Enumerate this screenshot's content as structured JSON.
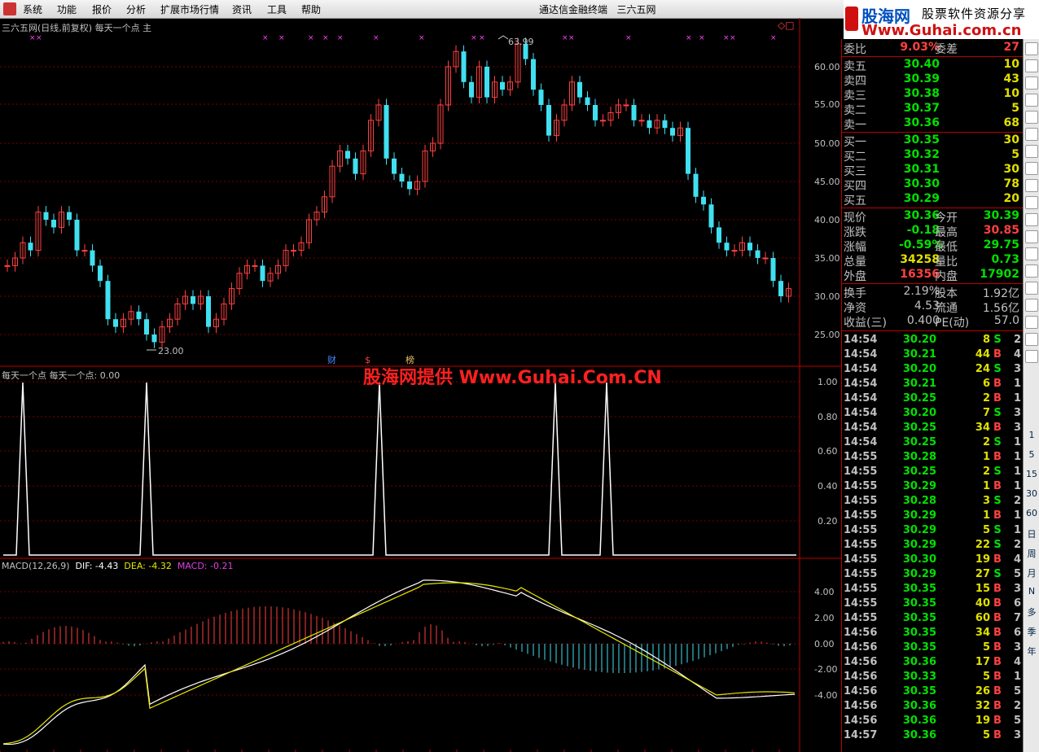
{
  "menu": {
    "items": [
      "系统",
      "功能",
      "报价",
      "分析",
      "扩展市场行情",
      "资讯",
      "工具",
      "帮助"
    ],
    "window_title": "通达信金融终端",
    "window_title2": "三六五网"
  },
  "logo": {
    "name": "股海网",
    "slogan": "股票软件资源分享",
    "url": "Www.Guhai.com.cn"
  },
  "kline": {
    "title": "三六五网(日线,前复权) 每天一个点 主",
    "y_ticks": [
      "60.00",
      "55.00",
      "50.00",
      "45.00",
      "40.00",
      "35.00",
      "30.00",
      "25.00"
    ],
    "high_label": "63.99",
    "low_label": "23.00",
    "event_tags": [
      "财",
      "$",
      "榜"
    ]
  },
  "indicator": {
    "title": "每天一个点  每天一个点: 0.00",
    "watermark": "股海网提供 Www.Guhai.Com.CN",
    "y_ticks": [
      "1.00",
      "0.80",
      "0.60",
      "0.40",
      "0.20"
    ]
  },
  "macd": {
    "title_name": "MACD(12,26,9)",
    "dif": "DIF: -4.43",
    "dea": "DEA: -4.32",
    "macd": "MACD: -0.21",
    "y_ticks": [
      "4.00",
      "2.00",
      "0.00",
      "-2.00",
      "-4.00"
    ]
  },
  "quote": {
    "weibi": {
      "label": "委比",
      "value": "9.03%",
      "label2": "委差",
      "value2": "27"
    },
    "sell": [
      {
        "label": "卖五",
        "price": "30.40",
        "vol": "10"
      },
      {
        "label": "卖四",
        "price": "30.39",
        "vol": "43"
      },
      {
        "label": "卖三",
        "price": "30.38",
        "vol": "10"
      },
      {
        "label": "卖二",
        "price": "30.37",
        "vol": "5"
      },
      {
        "label": "卖一",
        "price": "30.36",
        "vol": "68"
      }
    ],
    "buy": [
      {
        "label": "买一",
        "price": "30.35",
        "vol": "30"
      },
      {
        "label": "买二",
        "price": "30.32",
        "vol": "5"
      },
      {
        "label": "买三",
        "price": "30.31",
        "vol": "30"
      },
      {
        "label": "买四",
        "price": "30.30",
        "vol": "78"
      },
      {
        "label": "买五",
        "price": "30.29",
        "vol": "20"
      }
    ],
    "stats": [
      {
        "l1": "现价",
        "v1": "30.36",
        "c1": "green",
        "l2": "今开",
        "v2": "30.39",
        "c2": "green"
      },
      {
        "l1": "涨跌",
        "v1": "-0.18",
        "c1": "green",
        "l2": "最高",
        "v2": "30.85",
        "c2": "red"
      },
      {
        "l1": "涨幅",
        "v1": "-0.59%",
        "c1": "green",
        "l2": "最低",
        "v2": "29.75",
        "c2": "green"
      },
      {
        "l1": "总量",
        "v1": "34258",
        "c1": "yellow",
        "l2": "量比",
        "v2": "0.73",
        "c2": "green"
      },
      {
        "l1": "外盘",
        "v1": "16356",
        "c1": "red",
        "l2": "内盘",
        "v2": "17902",
        "c2": "green"
      }
    ],
    "fundamentals": [
      {
        "l1": "换手",
        "v1": "2.19%",
        "l2": "股本",
        "v2": "1.92亿"
      },
      {
        "l1": "净资",
        "v1": "4.53",
        "l2": "流通",
        "v2": "1.56亿"
      },
      {
        "l1": "收益(三)",
        "v1": "0.400",
        "l2": "PE(动)",
        "v2": "57.0"
      }
    ],
    "ticks": [
      {
        "t": "14:54",
        "p": "30.20",
        "v": "8",
        "s": "S",
        "n": "2"
      },
      {
        "t": "14:54",
        "p": "30.21",
        "v": "44",
        "s": "B",
        "n": "4"
      },
      {
        "t": "14:54",
        "p": "30.20",
        "v": "24",
        "s": "S",
        "n": "3"
      },
      {
        "t": "14:54",
        "p": "30.21",
        "v": "6",
        "s": "B",
        "n": "1"
      },
      {
        "t": "14:54",
        "p": "30.25",
        "v": "2",
        "s": "B",
        "n": "1"
      },
      {
        "t": "14:54",
        "p": "30.20",
        "v": "7",
        "s": "S",
        "n": "3"
      },
      {
        "t": "14:54",
        "p": "30.25",
        "v": "34",
        "s": "B",
        "n": "3"
      },
      {
        "t": "14:54",
        "p": "30.25",
        "v": "2",
        "s": "S",
        "n": "1"
      },
      {
        "t": "14:55",
        "p": "30.28",
        "v": "1",
        "s": "B",
        "n": "1"
      },
      {
        "t": "14:55",
        "p": "30.25",
        "v": "2",
        "s": "S",
        "n": "1"
      },
      {
        "t": "14:55",
        "p": "30.29",
        "v": "1",
        "s": "B",
        "n": "1"
      },
      {
        "t": "14:55",
        "p": "30.28",
        "v": "3",
        "s": "S",
        "n": "2"
      },
      {
        "t": "14:55",
        "p": "30.29",
        "v": "1",
        "s": "B",
        "n": "1"
      },
      {
        "t": "14:55",
        "p": "30.29",
        "v": "5",
        "s": "S",
        "n": "1"
      },
      {
        "t": "14:55",
        "p": "30.29",
        "v": "22",
        "s": "S",
        "n": "2"
      },
      {
        "t": "14:55",
        "p": "30.30",
        "v": "19",
        "s": "B",
        "n": "4"
      },
      {
        "t": "14:55",
        "p": "30.29",
        "v": "27",
        "s": "S",
        "n": "5"
      },
      {
        "t": "14:55",
        "p": "30.35",
        "v": "15",
        "s": "B",
        "n": "3"
      },
      {
        "t": "14:55",
        "p": "30.35",
        "v": "40",
        "s": "B",
        "n": "6"
      },
      {
        "t": "14:55",
        "p": "30.35",
        "v": "60",
        "s": "B",
        "n": "7"
      },
      {
        "t": "14:56",
        "p": "30.35",
        "v": "34",
        "s": "B",
        "n": "6"
      },
      {
        "t": "14:56",
        "p": "30.35",
        "v": "5",
        "s": "B",
        "n": "3"
      },
      {
        "t": "14:56",
        "p": "30.36",
        "v": "17",
        "s": "B",
        "n": "4"
      },
      {
        "t": "14:56",
        "p": "30.33",
        "v": "5",
        "s": "B",
        "n": "1"
      },
      {
        "t": "14:56",
        "p": "30.35",
        "v": "26",
        "s": "B",
        "n": "5"
      },
      {
        "t": "14:56",
        "p": "30.36",
        "v": "32",
        "s": "B",
        "n": "2"
      },
      {
        "t": "14:56",
        "p": "30.36",
        "v": "19",
        "s": "B",
        "n": "5"
      },
      {
        "t": "14:57",
        "p": "30.36",
        "v": "5",
        "s": "B",
        "n": "3"
      }
    ]
  },
  "toolbar": {
    "labels": [
      "1",
      "5",
      "15",
      "30",
      "60",
      "日",
      "周",
      "月",
      "N",
      "多",
      "季",
      "年"
    ]
  }
}
